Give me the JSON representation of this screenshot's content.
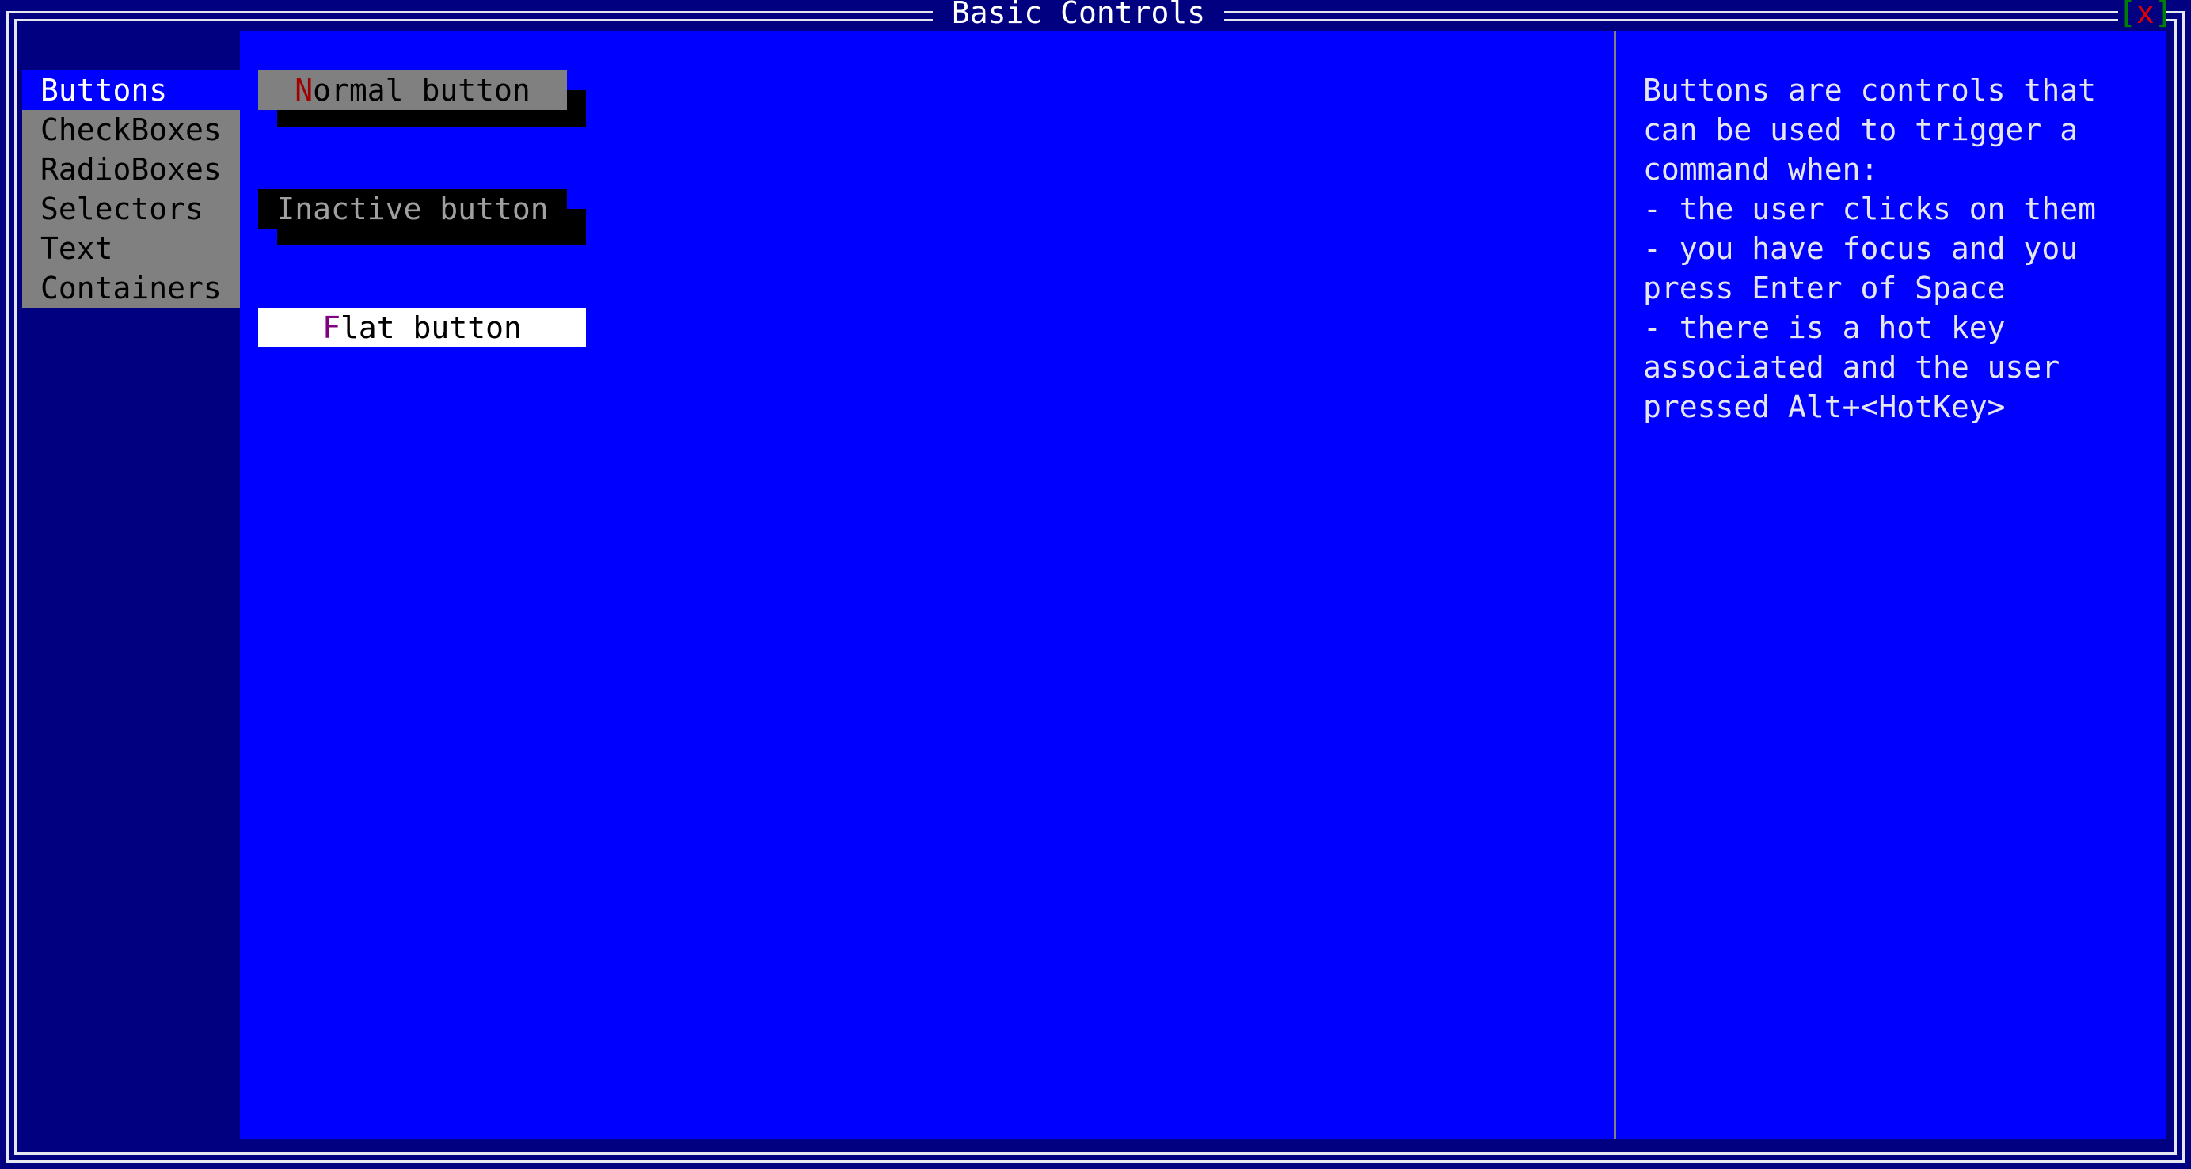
{
  "window": {
    "title": "Basic Controls",
    "close": {
      "bracket_left": "[",
      "label": "x",
      "bracket_right": "]"
    }
  },
  "sidebar": {
    "items": [
      {
        "label": "Buttons",
        "selected": true
      },
      {
        "label": "CheckBoxes",
        "selected": false
      },
      {
        "label": "RadioBoxes",
        "selected": false
      },
      {
        "label": "Selectors",
        "selected": false
      },
      {
        "label": "Text",
        "selected": false
      },
      {
        "label": "Containers",
        "selected": false
      }
    ]
  },
  "buttons": {
    "normal": {
      "hotkey": "N",
      "rest": "ormal button"
    },
    "inactive": {
      "label": "Inactive button"
    },
    "flat": {
      "hotkey": "F",
      "rest": "lat button"
    }
  },
  "description": {
    "lines": [
      "Buttons are controls that",
      "can be used to trigger a",
      "command when:",
      "- the user clicks on them",
      "- you have focus and you",
      "press Enter of Space",
      "- there is a hot key",
      "associated and the user",
      "pressed Alt+<HotKey>"
    ]
  },
  "colors": {
    "desktop": "#000080",
    "panel": "#0000ff",
    "sidebar_item": "#808080",
    "hotkey_normal": "#a00000",
    "hotkey_flat": "#800080",
    "close_x": "#e00000",
    "close_bracket": "#008000"
  }
}
